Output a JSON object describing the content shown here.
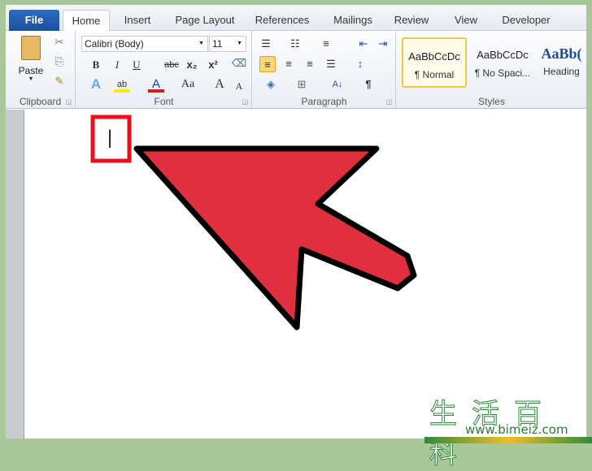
{
  "tabs": [
    "File",
    "Home",
    "Insert",
    "Page Layout",
    "References",
    "Mailings",
    "Review",
    "View",
    "Developer"
  ],
  "active_tab": "Home",
  "clipboard": {
    "paste": "Paste",
    "label": "Clipboard"
  },
  "font": {
    "family": "Calibri (Body)",
    "size": "11",
    "label": "Font",
    "bold": "B",
    "italic": "I",
    "underline": "U",
    "strike": "abc",
    "subscript": "x₂",
    "superscript": "x²",
    "change_case": "Aa",
    "grow": "A",
    "shrink": "A",
    "effects": "A",
    "font_color": "A",
    "highlight": "ab"
  },
  "paragraph": {
    "label": "Paragraph",
    "pilcrow": "¶",
    "sort": "A↓"
  },
  "styles": {
    "label": "Styles",
    "items": [
      {
        "preview": "AaBbCcDc",
        "name": "¶ Normal"
      },
      {
        "preview": "AaBbCcDc",
        "name": "¶ No Spaci..."
      },
      {
        "preview": "AaBb(",
        "name": "Heading"
      }
    ]
  },
  "document": {
    "cursor": "|"
  },
  "colors": {
    "arrow": "#e03040",
    "highlight_box": "#e8101a",
    "accent": "#2c6bc4"
  },
  "watermark": {
    "chars": "生活百科",
    "url": "www.bimeiz.com",
    "is_logo": true
  }
}
